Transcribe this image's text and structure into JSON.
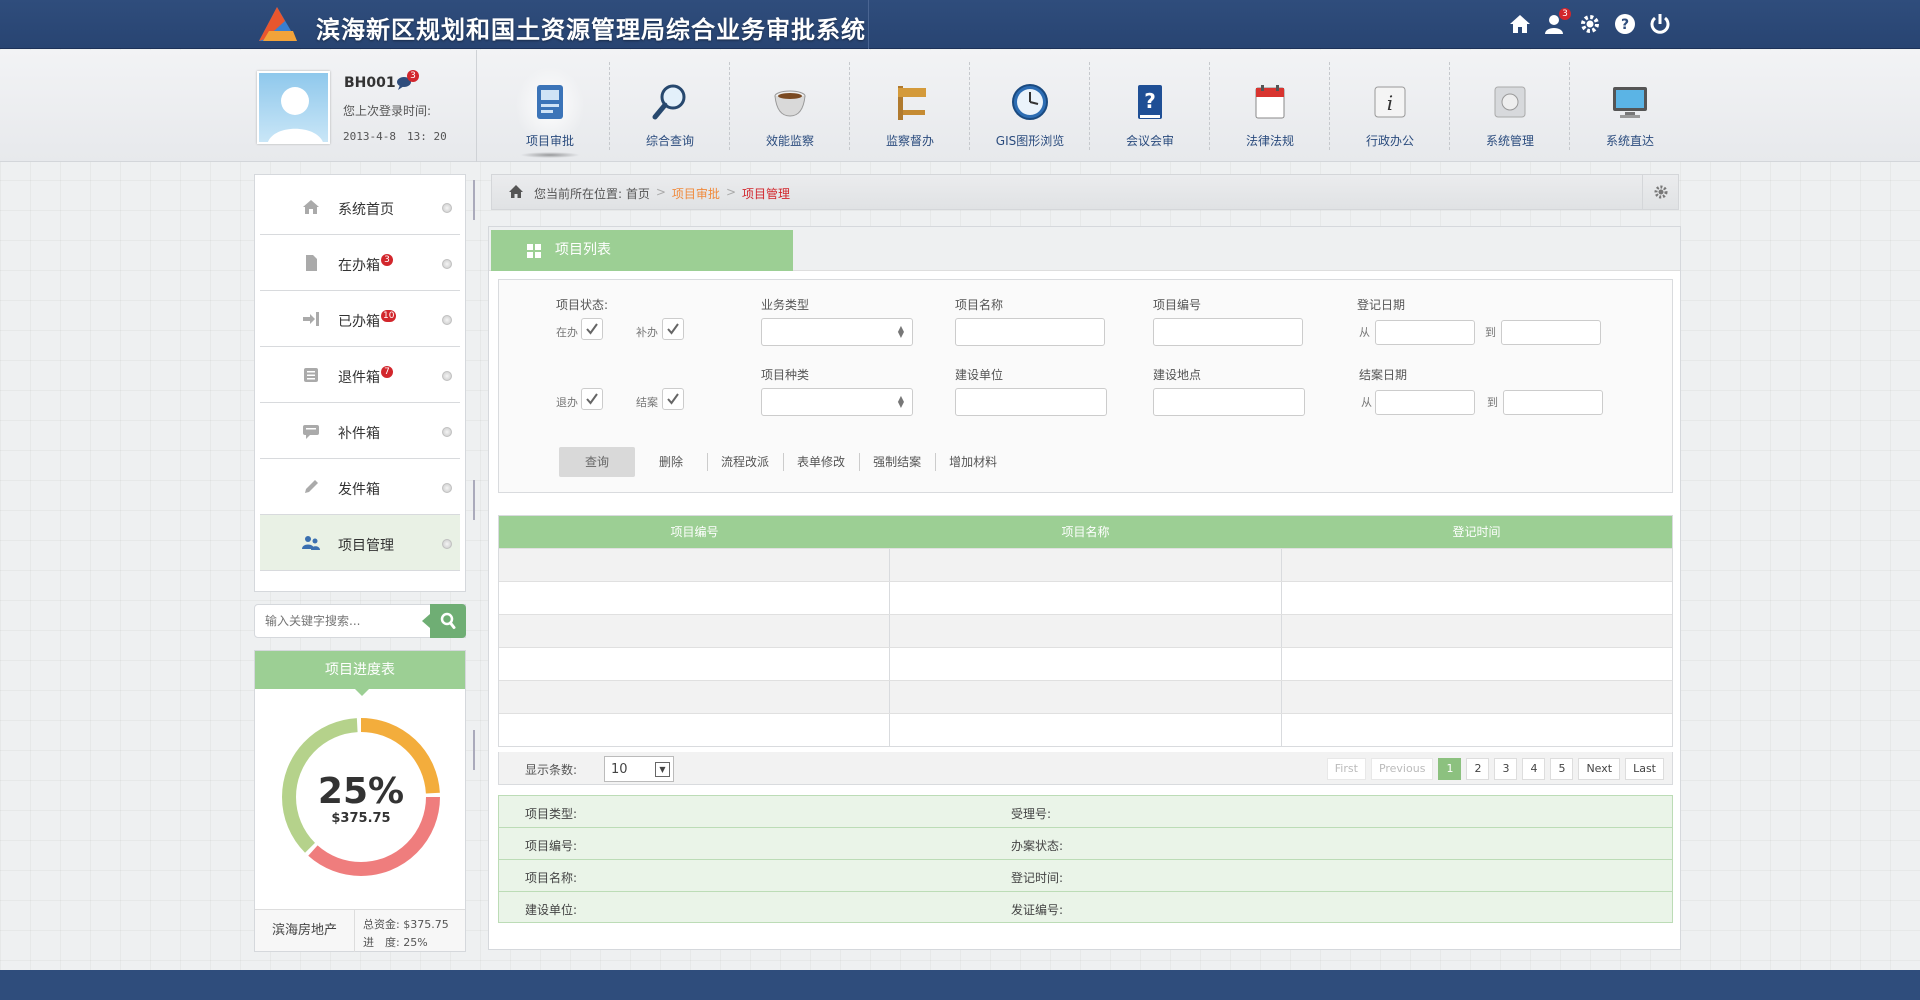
{
  "header": {
    "title": "滨海新区规划和国土资源管理局综合业务审批系统",
    "message_count": "3",
    "icons": [
      "home-icon",
      "user-message-icon",
      "settings-icon",
      "help-icon",
      "power-icon"
    ]
  },
  "user": {
    "name": "BH001",
    "message_count": "3",
    "last_login_label": "您上次登录时间:",
    "last_login_time": "2013-4-8　13: 20"
  },
  "nav": [
    {
      "label": "项目审批",
      "icon": "project-approval-icon",
      "active": true
    },
    {
      "label": "综合查询",
      "icon": "magnifier-icon"
    },
    {
      "label": "效能监察",
      "icon": "cup-icon"
    },
    {
      "label": "监察督办",
      "icon": "signpost-icon"
    },
    {
      "label": "GIS图形浏览",
      "icon": "clock-globe-icon"
    },
    {
      "label": "会议会审",
      "icon": "question-book-icon"
    },
    {
      "label": "法律法规",
      "icon": "calendar-icon"
    },
    {
      "label": "行政办公",
      "icon": "info-icon"
    },
    {
      "label": "系统管理",
      "icon": "system-icon"
    },
    {
      "label": "系统直达",
      "icon": "monitor-icon"
    }
  ],
  "sidebar": {
    "items": [
      {
        "label": "系统首页",
        "icon": "home-icon",
        "badge": ""
      },
      {
        "label": "在办箱",
        "icon": "document-icon",
        "badge": "3"
      },
      {
        "label": "已办箱",
        "icon": "sign-in-icon",
        "badge": "10"
      },
      {
        "label": "退件箱",
        "icon": "list-icon",
        "badge": "7"
      },
      {
        "label": "补件箱",
        "icon": "comment-icon",
        "badge": ""
      },
      {
        "label": "发件箱",
        "icon": "pencil-icon",
        "badge": ""
      },
      {
        "label": "项目管理",
        "icon": "users-icon",
        "badge": "",
        "active": true
      }
    ],
    "search_placeholder": "输入关键字搜索...",
    "progress": {
      "title": "项目进度表",
      "percent_value": 25,
      "percent_text": "25%",
      "amount": "$375.75",
      "company": "滨海房地产",
      "total_line": "总资金: $375.75",
      "progress_line": "进　度: 25%",
      "colors": {
        "done": "#f3ad3c",
        "remaining_a": "#ef7d7d",
        "remaining_b": "#b5d28b"
      }
    }
  },
  "breadcrumb": {
    "prefix": "您当前所在位置: 首页",
    "sep": ">",
    "level1": "项目审批",
    "level2": "项目管理"
  },
  "panel": {
    "tab_label": "项目列表",
    "filters": {
      "status_label": "项目状态:",
      "cb_in_progress": "在办",
      "cb_supplement": "补办",
      "cb_returned": "退办",
      "cb_closed": "结案",
      "business_type_label": "业务类型",
      "project_name_label": "项目名称",
      "project_no_label": "项目编号",
      "reg_date_label": "登记日期",
      "project_kind_label": "项目种类",
      "builder_label": "建设单位",
      "site_label": "建设地点",
      "close_date_label": "结案日期",
      "from": "从",
      "to": "到"
    },
    "actions": {
      "query": "查询",
      "delete": "删除",
      "reroute": "流程改派",
      "edit_form": "表单修改",
      "force_close": "强制结案",
      "add_material": "增加材料"
    },
    "table": {
      "columns": [
        "项目编号",
        "项目名称",
        "登记时间"
      ],
      "rows": [
        [
          "",
          "",
          ""
        ],
        [
          "",
          "",
          ""
        ],
        [
          "",
          "",
          ""
        ],
        [
          "",
          "",
          ""
        ],
        [
          "",
          "",
          ""
        ],
        [
          "",
          "",
          ""
        ]
      ]
    },
    "pager": {
      "page_size_label": "显示条数:",
      "page_size": "10",
      "first": "First",
      "previous": "Previous",
      "pages": [
        "1",
        "2",
        "3",
        "4",
        "5"
      ],
      "current": "1",
      "next": "Next",
      "last": "Last"
    },
    "detail": [
      {
        "left": "项目类型:",
        "right": "受理号:"
      },
      {
        "left": "项目编号:",
        "right": "办案状态:"
      },
      {
        "left": "项目名称:",
        "right": "登记时间:"
      },
      {
        "left": "建设单位:",
        "right": "发证编号:"
      }
    ]
  },
  "colors": {
    "brand": "#2f4d7c",
    "accent_green": "#9ccf94",
    "badge_red": "#d2262c"
  }
}
